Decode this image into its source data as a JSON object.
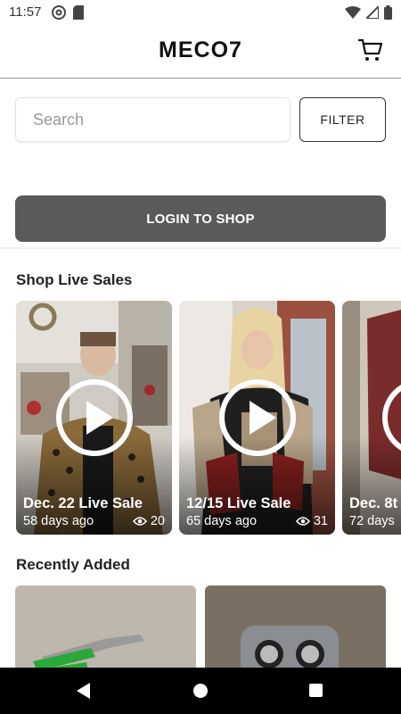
{
  "status_bar": {
    "time": "11:57",
    "left_icons": [
      "at-sign-icon",
      "sd-card-icon"
    ],
    "right_icons": [
      "wifi-icon",
      "signal-icon",
      "battery-icon"
    ]
  },
  "header": {
    "title": "MECO7",
    "cart_icon": "cart-icon"
  },
  "search": {
    "placeholder": "Search",
    "value": ""
  },
  "filter": {
    "label": "FILTER"
  },
  "login": {
    "label": "LOGIN TO SHOP"
  },
  "live_sales": {
    "title": "Shop Live Sales",
    "cards": [
      {
        "title": "Dec. 22 Live Sale",
        "age": "58 days ago",
        "views": "20"
      },
      {
        "title": "12/15 Live Sale",
        "age": "65 days ago",
        "views": "31"
      },
      {
        "title": "Dec. 8t",
        "age": "72 days",
        "views": ""
      }
    ]
  },
  "recently_added": {
    "title": "Recently Added"
  },
  "colors": {
    "login_button_bg": "#5a5a5a",
    "header_divider": "#9a9a9a"
  }
}
